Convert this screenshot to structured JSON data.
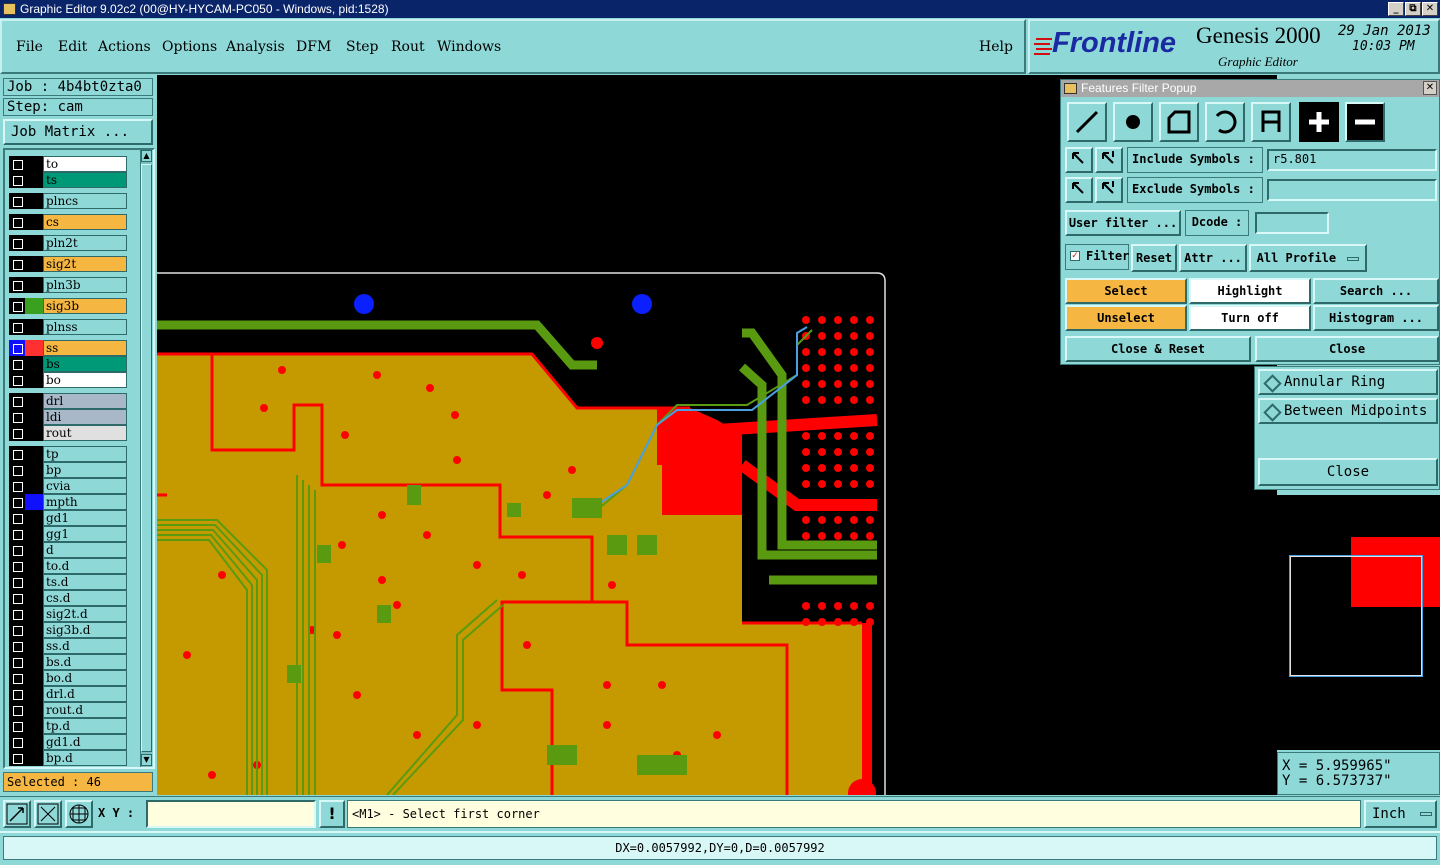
{
  "window": {
    "title": "Graphic Editor 9.02c2 (00@HY-HYCAM-PC050 - Windows, pid:1528)",
    "min": "_",
    "max": "⧉",
    "close": "✕"
  },
  "menu": [
    "File",
    "Edit",
    "Actions",
    "Options",
    "Analysis",
    "DFM",
    "Step",
    "Rout",
    "Windows"
  ],
  "help": "Help",
  "brand": {
    "logo": "Frontline",
    "product": "Genesis 2000",
    "subtitle": "Graphic Editor",
    "date": "29 Jan 2013",
    "time": "10:03 PM"
  },
  "job": {
    "job_label": "Job : 4b4bt0zta0",
    "step_label": "Step: cam",
    "matrix_button": "Job Matrix ..."
  },
  "layers": [
    {
      "name": "to",
      "color": "#ffffff",
      "swatch": "#000000"
    },
    {
      "name": "ts",
      "color": "#009977",
      "swatch": "#000000"
    },
    {
      "name": "plncs",
      "color": "#8fd8d8",
      "swatch": "#000000"
    },
    {
      "name": "cs",
      "color": "#f5b742",
      "swatch": "#000000"
    },
    {
      "name": "pln2t",
      "color": "#8fd8d8",
      "swatch": "#000000"
    },
    {
      "name": "sig2t",
      "color": "#f5b742",
      "swatch": "#000000"
    },
    {
      "name": "pln3b",
      "color": "#8fd8d8",
      "swatch": "#000000"
    },
    {
      "name": "sig3b",
      "color": "#f5b742",
      "swatch": "#3aa020"
    },
    {
      "name": "plnss",
      "color": "#8fd8d8",
      "swatch": "#000000"
    },
    {
      "name": "ss",
      "color": "#f5b742",
      "swatch": "#ff3030"
    },
    {
      "name": "bs",
      "color": "#009977",
      "swatch": "#000000"
    },
    {
      "name": "bo",
      "color": "#ffffff",
      "swatch": "#000000"
    },
    {
      "name": "drl",
      "color": "#a8b8c8",
      "swatch": "#000000"
    },
    {
      "name": "ldi",
      "color": "#a8b8c8",
      "swatch": "#000000"
    },
    {
      "name": "rout",
      "color": "#e0e0e0",
      "swatch": "#000000"
    },
    {
      "name": "tp",
      "color": "#8fd8d8",
      "swatch": "#000000"
    },
    {
      "name": "bp",
      "color": "#8fd8d8",
      "swatch": "#000000"
    },
    {
      "name": "cvia",
      "color": "#8fd8d8",
      "swatch": "#000000"
    },
    {
      "name": "mpth",
      "color": "#8fd8d8",
      "swatch": "#1010ff"
    },
    {
      "name": "gd1",
      "color": "#8fd8d8",
      "swatch": "#000000"
    },
    {
      "name": "gg1",
      "color": "#8fd8d8",
      "swatch": "#000000"
    },
    {
      "name": "d",
      "color": "#8fd8d8",
      "swatch": "#000000"
    },
    {
      "name": "to.d",
      "color": "#8fd8d8",
      "swatch": "#000000"
    },
    {
      "name": "ts.d",
      "color": "#8fd8d8",
      "swatch": "#000000"
    },
    {
      "name": "cs.d",
      "color": "#8fd8d8",
      "swatch": "#000000"
    },
    {
      "name": "sig2t.d",
      "color": "#8fd8d8",
      "swatch": "#000000"
    },
    {
      "name": "sig3b.d",
      "color": "#8fd8d8",
      "swatch": "#000000"
    },
    {
      "name": "ss.d",
      "color": "#8fd8d8",
      "swatch": "#000000"
    },
    {
      "name": "bs.d",
      "color": "#8fd8d8",
      "swatch": "#000000"
    },
    {
      "name": "bo.d",
      "color": "#8fd8d8",
      "swatch": "#000000"
    },
    {
      "name": "drl.d",
      "color": "#8fd8d8",
      "swatch": "#000000"
    },
    {
      "name": "rout.d",
      "color": "#8fd8d8",
      "swatch": "#000000"
    },
    {
      "name": "tp.d",
      "color": "#8fd8d8",
      "swatch": "#000000"
    },
    {
      "name": "gd1.d",
      "color": "#8fd8d8",
      "swatch": "#000000"
    },
    {
      "name": "bp.d",
      "color": "#8fd8d8",
      "swatch": "#000000"
    }
  ],
  "selected": "Selected : 46",
  "filter_popup": {
    "title": "Features Filter Popup",
    "tool_icons": [
      "line-icon",
      "pad-icon",
      "surface-icon",
      "arc-icon",
      "text-icon",
      "positive-icon",
      "negative-icon"
    ],
    "include_label": "Include Symbols :",
    "include_value": "r5.801",
    "exclude_label": "Exclude Symbols :",
    "exclude_value": "",
    "user_filter": "User filter ...",
    "dcode_label": "Dcode :",
    "dcode_value": "",
    "filter_label": "Filter",
    "reset": "Reset",
    "attr": "Attr ...",
    "profile": "All Profile",
    "select": "Select",
    "highlight": "Highlight",
    "search": "Search ...",
    "unselect": "Unselect",
    "turn_off": "Turn off",
    "histogram": "Histogram ...",
    "close_reset": "Close & Reset",
    "close": "Close"
  },
  "snap_popup": {
    "annular": "Annular Ring",
    "midpoints": "Between Midpoints",
    "close": "Close"
  },
  "coords": {
    "x": "X =  5.959965\"",
    "y": "Y =  6.573737\""
  },
  "bottom": {
    "xy_label": "X Y :",
    "xy_value": "",
    "exclaim": "!",
    "prompt": "<M1> - Select first corner",
    "units": "Inch"
  },
  "status": "DX=0.0057992,DY=0,D=0.0057992",
  "colors": {
    "copper": "#c49a00",
    "trace_red": "#ff0000",
    "trace_green": "#5a9a10",
    "accent_orange": "#f5b742"
  }
}
